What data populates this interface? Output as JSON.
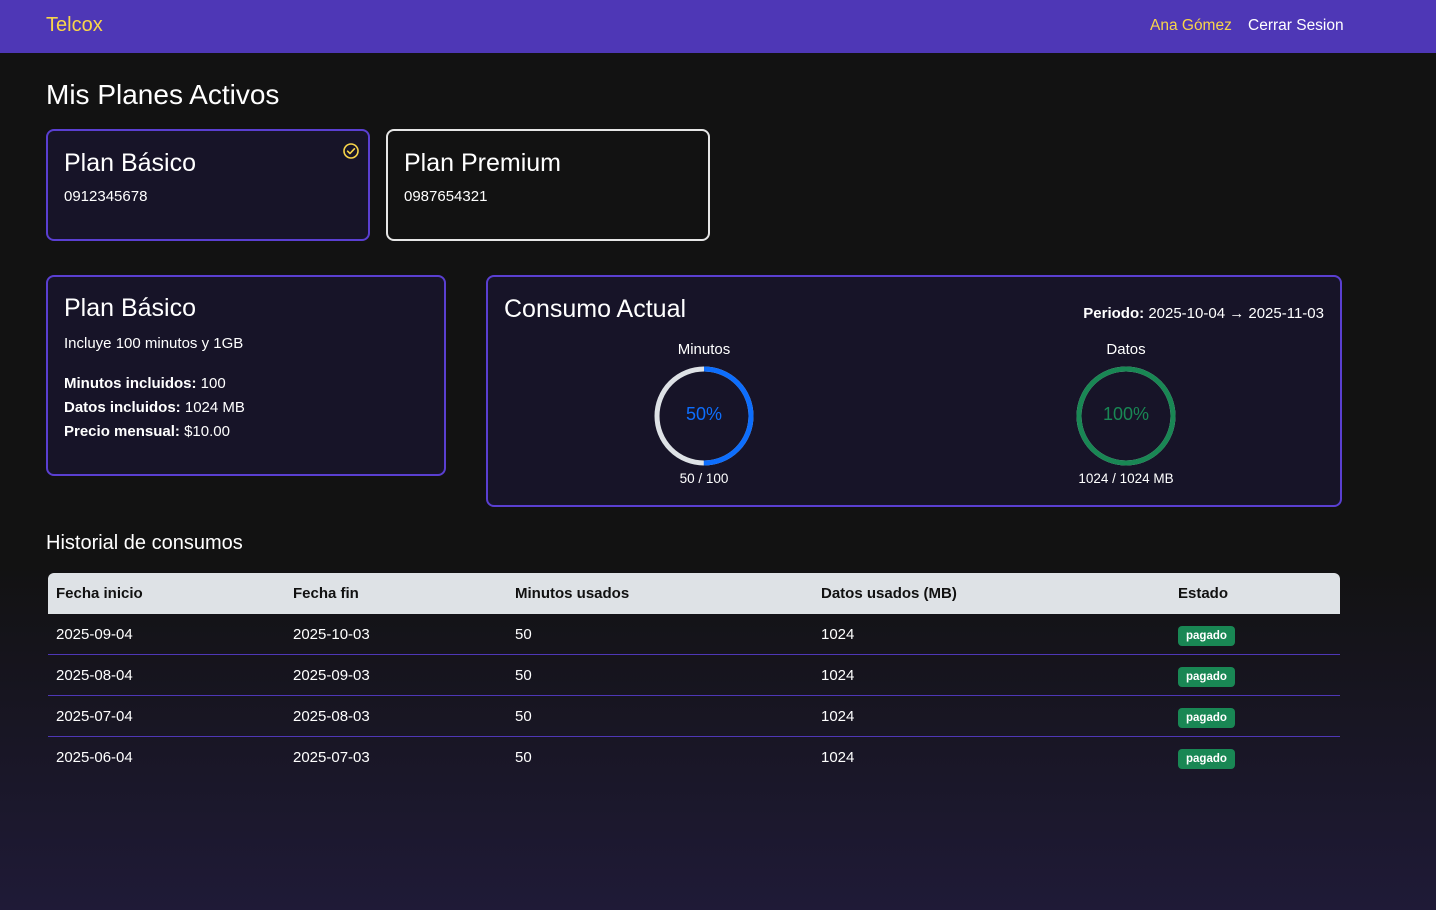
{
  "navbar": {
    "brand": "Telcox",
    "user": "Ana Gómez",
    "logout": "Cerrar Sesion"
  },
  "page_title": "Mis Planes Activos",
  "plans": [
    {
      "name": "Plan Básico",
      "phone": "0912345678",
      "selected": true
    },
    {
      "name": "Plan Premium",
      "phone": "0987654321",
      "selected": false
    }
  ],
  "detail": {
    "name": "Plan Básico",
    "description": "Incluye 100 minutos y 1GB",
    "minutes_label": "Minutos incluidos:",
    "minutes_value": "100",
    "data_label": "Datos incluidos:",
    "data_value": "1024 MB",
    "price_label": "Precio mensual:",
    "price_value": "$10.00"
  },
  "consumo": {
    "title": "Consumo Actual",
    "periodo_label": "Periodo:",
    "periodo_value": "2025-10-04 → 2025-11-03",
    "minutos": {
      "label": "Minutos",
      "percent_text": "50%",
      "fraction": 0.5,
      "detail": "50 / 100",
      "color": "#0d6efd"
    },
    "datos": {
      "label": "Datos",
      "percent_text": "100%",
      "fraction": 1.0,
      "detail": "1024 / 1024 MB",
      "color": "#198754"
    }
  },
  "history": {
    "title": "Historial de consumos",
    "headers": [
      "Fecha inicio",
      "Fecha fin",
      "Minutos usados",
      "Datos usados (MB)",
      "Estado"
    ],
    "rows": [
      [
        "2025-09-04",
        "2025-10-03",
        "50",
        "1024",
        "pagado"
      ],
      [
        "2025-08-04",
        "2025-09-03",
        "50",
        "1024",
        "pagado"
      ],
      [
        "2025-07-04",
        "2025-08-03",
        "50",
        "1024",
        "pagado"
      ],
      [
        "2025-06-04",
        "2025-07-03",
        "50",
        "1024",
        "pagado"
      ]
    ]
  },
  "colors": {
    "accent": "#4e37b6",
    "brand": "#f8d54a",
    "badge": "#198754"
  }
}
